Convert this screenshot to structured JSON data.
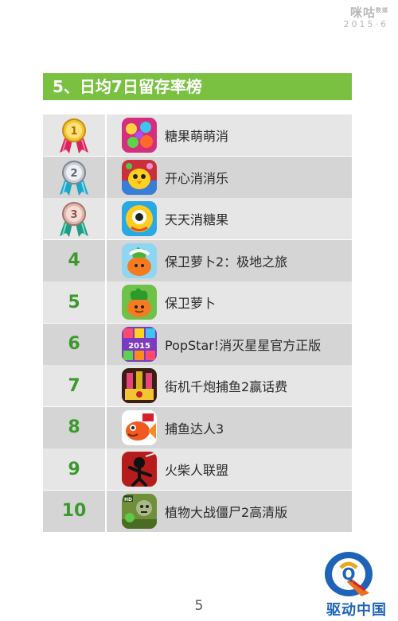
{
  "brand": {
    "logo_text": "咪咕",
    "logo_sup": "数媒",
    "date": "2015·6"
  },
  "section_title": "5、日均7日留存率榜",
  "rows": [
    {
      "rank": "1",
      "name": "糖果萌萌消",
      "medal": "gold",
      "icon": "candy-icon"
    },
    {
      "rank": "2",
      "name": "开心消消乐",
      "medal": "silver",
      "icon": "chick-icon"
    },
    {
      "rank": "3",
      "name": "天天消糖果",
      "medal": "bronze",
      "icon": "candy-eye-icon"
    },
    {
      "rank": "4",
      "name": "保卫萝卜2：极地之旅",
      "icon": "carrot-snow-icon"
    },
    {
      "rank": "5",
      "name": "保卫萝卜",
      "icon": "carrot-icon"
    },
    {
      "rank": "6",
      "name": "PopStar!消灭星星官方正版",
      "icon": "popstar-icon"
    },
    {
      "rank": "7",
      "name": "街机千炮捕鱼2赢话费",
      "icon": "fishing-cannon-icon"
    },
    {
      "rank": "8",
      "name": "捕鱼达人3",
      "icon": "goldfish-icon"
    },
    {
      "rank": "9",
      "name": "火柴人联盟",
      "icon": "stickman-icon"
    },
    {
      "rank": "10",
      "name": "植物大战僵尸2高清版",
      "icon": "zombie-icon"
    }
  ],
  "page_number": "5",
  "watermark": {
    "text": "驱动中国",
    "logo_letter": "Q"
  }
}
